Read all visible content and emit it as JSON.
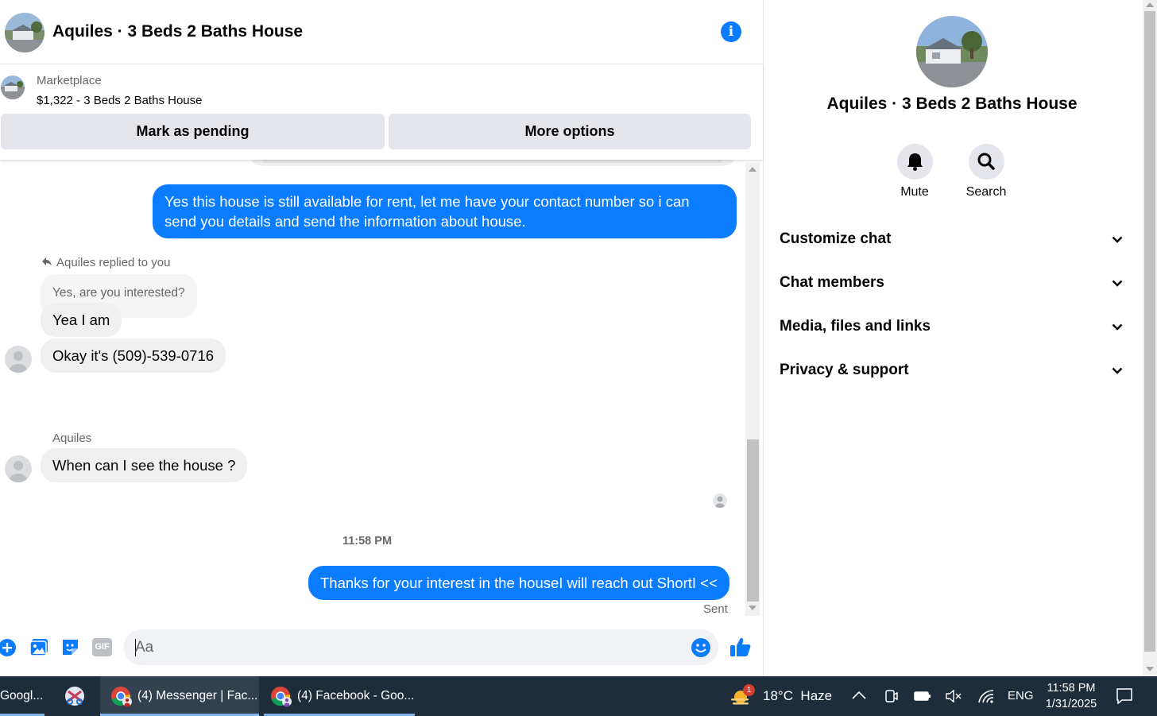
{
  "header": {
    "title": "Aquiles · 3 Beds 2 Baths House",
    "info_icon": "info-icon"
  },
  "marketplace": {
    "label": "Marketplace",
    "listing": "$1,322 - 3 Beds 2 Baths House",
    "pending_button": "Mark as pending",
    "more_button": "More options"
  },
  "messages": {
    "outgoing_1": "Yes this house is still available for rent, let me have your contact number so i can send you details and send the information about house.",
    "reply_note": "Aquiles replied to you",
    "quoted": "Yes, are you interested?",
    "incoming_1": "Yea I am",
    "incoming_2": "Okay it's (509)-539-0716",
    "sender_name": "Aquiles",
    "incoming_3": "When can I see the house ?",
    "timestamp": "11:58 PM",
    "outgoing_2": "Thanks for your interest in the houseI will reach out ShortI <<",
    "status": "Sent"
  },
  "composer": {
    "placeholder": "Aa",
    "gif_label": "GIF"
  },
  "right_panel": {
    "title": "Aquiles · 3 Beds 2 Baths House",
    "mute_label": "Mute",
    "search_label": "Search",
    "sections": [
      "Customize chat",
      "Chat members",
      "Media, files and links",
      "Privacy & support"
    ]
  },
  "taskbar": {
    "app_1": "Googl...",
    "app_2": "(4) Messenger | Fac...",
    "app_3": "(4) Facebook - Goo...",
    "weather": "18°C  Haze",
    "weather_badge": "1",
    "language": "ENG",
    "time": "11:58 PM",
    "date": "1/31/2025"
  },
  "colors": {
    "accent": "#0a7cff",
    "bubble_in": "#f0f0f0",
    "button_grey": "#e4e6eb",
    "taskbar": "#1f2c3a"
  }
}
